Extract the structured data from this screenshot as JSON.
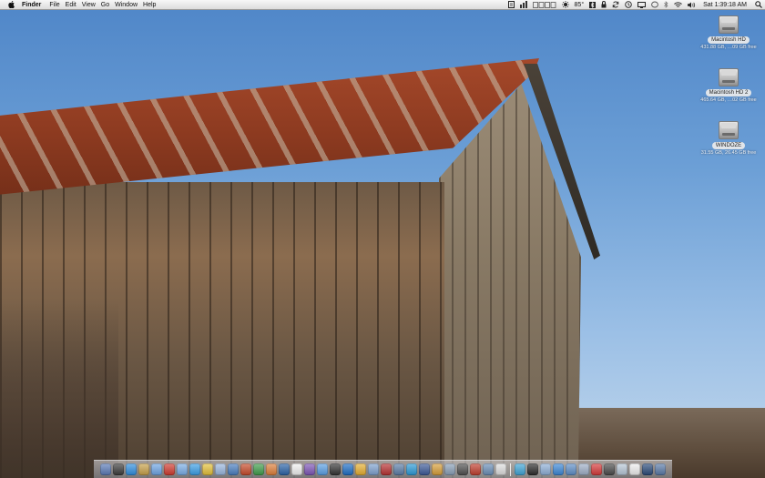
{
  "menubar": {
    "app_name": "Finder",
    "menus": [
      "File",
      "Edit",
      "View",
      "Go",
      "Window",
      "Help"
    ],
    "temperature": "85°",
    "clock": "Sat 1:39:18 AM"
  },
  "desktop_icons": [
    {
      "label": "Macintosh HD",
      "sub": "431.88 GB, …09 GB free"
    },
    {
      "label": "Macintosh HD 2",
      "sub": "465.64 GB, …02 GB free"
    },
    {
      "label": "WINDOZE",
      "sub": "31.55 GB, 26.45 GB free"
    }
  ],
  "dock": {
    "app_colors": [
      "#5b7bb8",
      "#3a3a3a",
      "#2f8fe0",
      "#c9a24a",
      "#6fa6e6",
      "#d23b2f",
      "#7aaee8",
      "#3ba0e8",
      "#e6c23a",
      "#9ab7df",
      "#4a7fc1",
      "#c84b2a",
      "#3f9e4b",
      "#e0803a",
      "#2a63a8",
      "#f2f2f2",
      "#7f56b8",
      "#5aa0e6",
      "#333333",
      "#1e6fc7",
      "#e8b030",
      "#7fa2d0",
      "#b83232",
      "#5c7ea8",
      "#2b9bd8",
      "#3d5a99",
      "#d9a03a",
      "#8aa0b8",
      "#4f4f4f",
      "#c23e2e",
      "#6b8fb8",
      "#e0e0e0"
    ],
    "right_colors": [
      "#3fa6d8",
      "#2a2a2a",
      "#8fb0d8",
      "#3b88d8",
      "#5f8fc8",
      "#a0b0c8",
      "#d83a3a",
      "#4a4a4a",
      "#b8c8d8",
      "#f0f0f0",
      "#2a4a7a",
      "#5a7aa8"
    ]
  },
  "colors": {
    "menubar_top": "#f7f7f7",
    "sky": "#6c9fd6",
    "roof_rust": "#8c3a20"
  }
}
